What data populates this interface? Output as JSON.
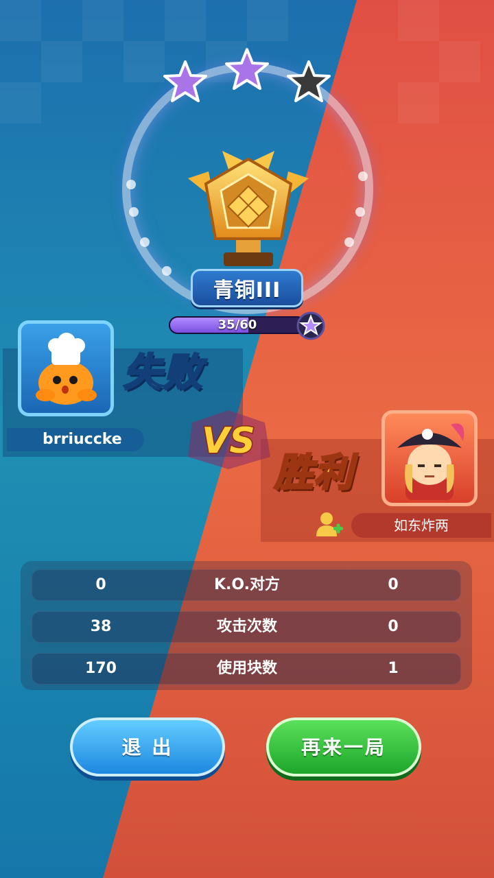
{
  "rank": {
    "title": "青铜III",
    "stars_earned": 2,
    "stars_total": 3,
    "progress_text": "35/60",
    "progress": 0.583
  },
  "vs_label": "VS",
  "players": {
    "left": {
      "name": "brriuccke",
      "result": "失败"
    },
    "right": {
      "name": "如东炸两",
      "result": "胜利"
    }
  },
  "stats": [
    {
      "left": "0",
      "label": "K.O.对方",
      "right": "0"
    },
    {
      "left": "38",
      "label": "攻击次数",
      "right": "0"
    },
    {
      "left": "170",
      "label": "使用块数",
      "right": "1"
    }
  ],
  "buttons": {
    "exit": "退 出",
    "again": "再来一局"
  },
  "colors": {
    "left_side": "#1f8fb8",
    "right_side": "#e85a3c",
    "exit_button": "#2aa0f0",
    "again_button": "#2fc23a",
    "star_earned": "#a874e8",
    "star_empty": "#3a3a3a"
  }
}
